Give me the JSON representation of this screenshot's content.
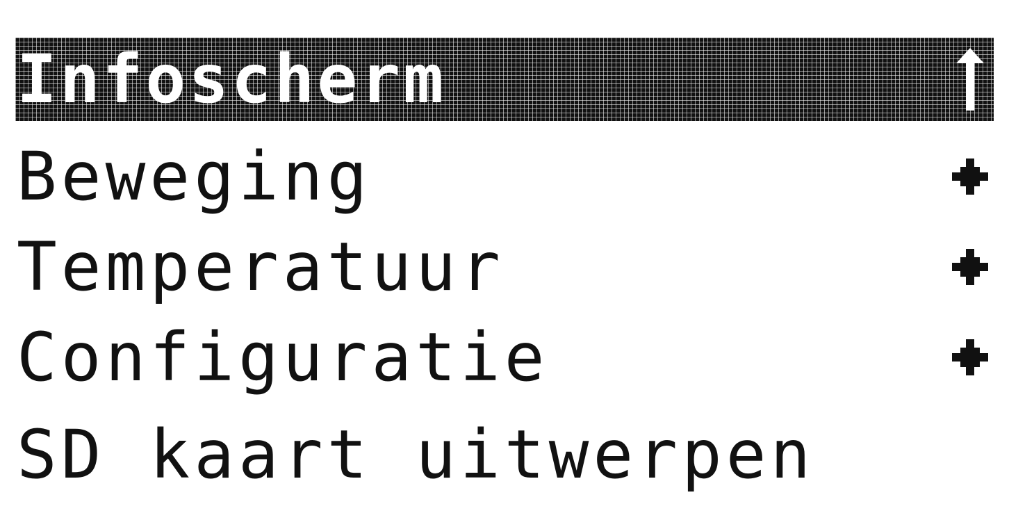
{
  "menu": {
    "title": "Infoscherm",
    "title_icon": "arrow-up-icon",
    "items": [
      {
        "label": "Beweging",
        "icon": "submenu-arrow-icon"
      },
      {
        "label": "Temperatuur",
        "icon": "submenu-arrow-icon"
      },
      {
        "label": "Configuratie",
        "icon": "submenu-arrow-icon"
      },
      {
        "label": "SD kaart uitwerpen",
        "icon": ""
      }
    ]
  },
  "colors": {
    "foreground": "#111111",
    "background": "#ffffff"
  }
}
